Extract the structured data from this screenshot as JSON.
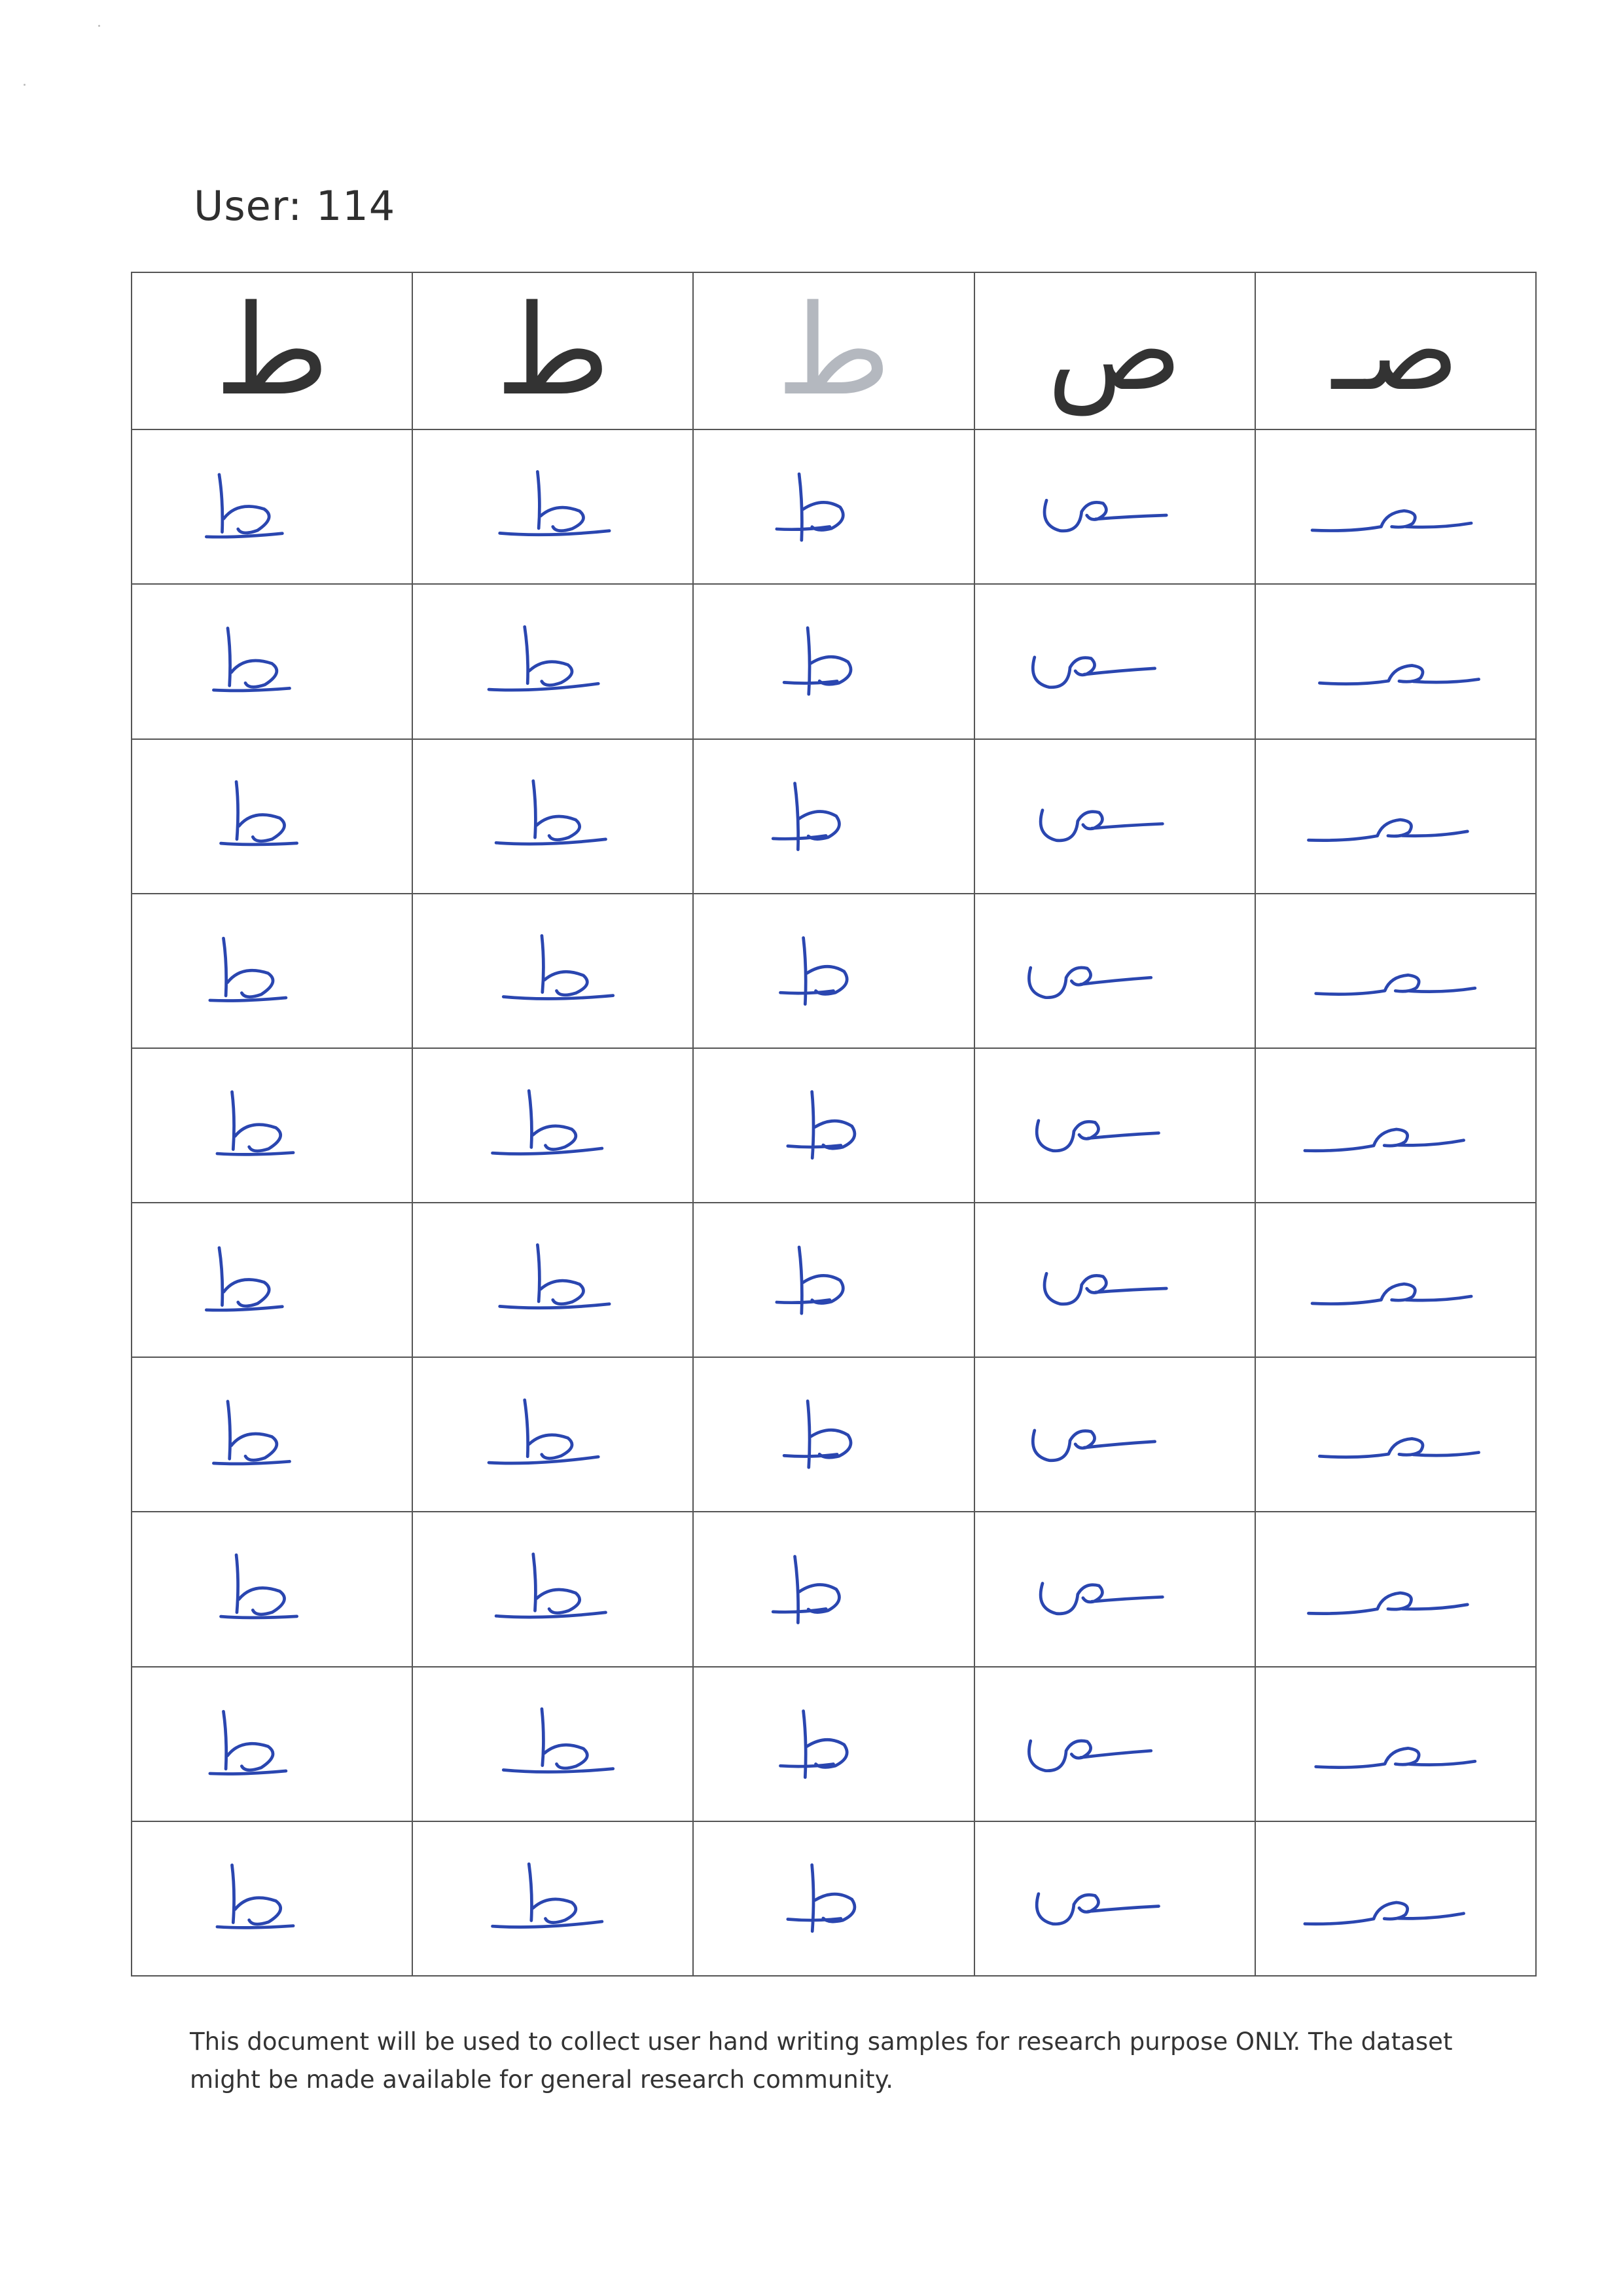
{
  "header": {
    "user_label": "User: 114"
  },
  "reference_row": [
    {
      "glyph": "ط",
      "style": "dark"
    },
    {
      "glyph": "ط",
      "style": "dark"
    },
    {
      "glyph": "ط",
      "style": "light"
    },
    {
      "glyph": "ص",
      "style": "dark"
    },
    {
      "glyph": "صـ",
      "style": "dark"
    }
  ],
  "sample_columns": [
    "ta-isolated",
    "ta-medial",
    "ta-outline",
    "sad-isolated",
    "sad-initial"
  ],
  "sample_rows": 10,
  "ink_color": "#2a46b0",
  "footer": {
    "disclaimer": "This document will be used to collect user hand writing samples for research purpose ONLY. The dataset might be made available for general research community."
  }
}
